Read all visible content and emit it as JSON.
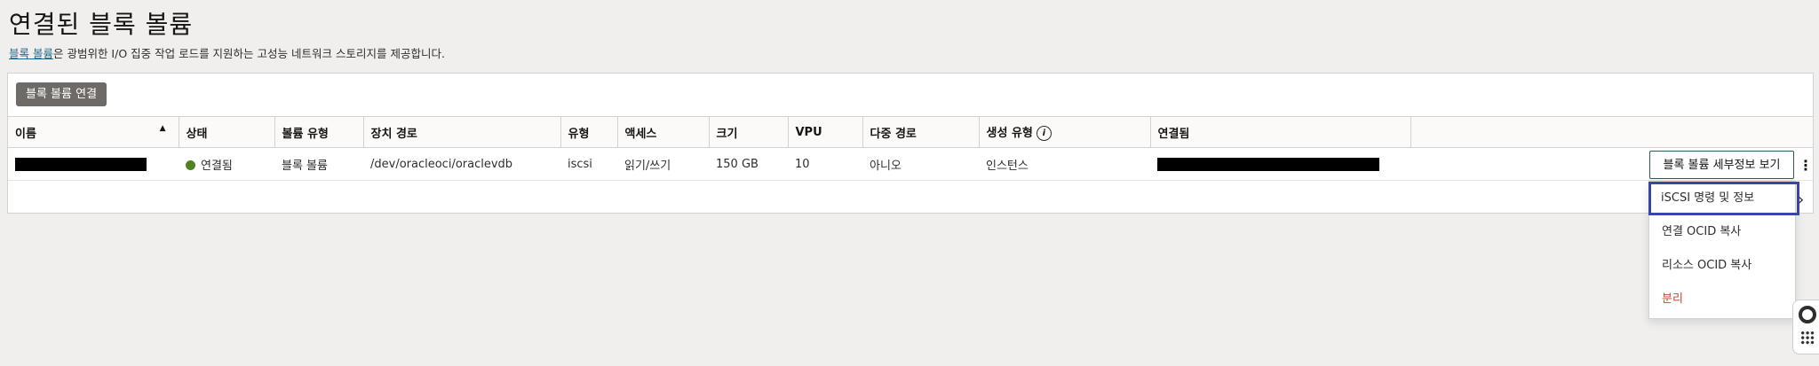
{
  "page": {
    "title": "연결된 블록 볼륨",
    "subtitle_link": "블록 볼륨",
    "subtitle_rest": "은 광범위한 I/O 집중 작업 로드를 지원하는 고성능 네트워크 스토리지를 제공합니다."
  },
  "toolbar": {
    "attach_label": "블록 볼륨 연결"
  },
  "table": {
    "headers": {
      "name": "이름",
      "state": "상태",
      "volume_type": "볼륨 유형",
      "device_path": "장치 경로",
      "type": "유형",
      "access": "액세스",
      "size": "크기",
      "vpu": "VPU",
      "multipath": "다중 경로",
      "created_type": "생성 유형",
      "attached": "연결됨"
    },
    "row": {
      "state": "연결됨",
      "volume_type": "블록 볼륨",
      "device_path": "/dev/oracleoci/oraclevdb",
      "type": "iscsi",
      "access": "읽기/쓰기",
      "size": "150 GB",
      "vpu": "10",
      "multipath": "아니오",
      "created_type": "인스턴스"
    }
  },
  "actions": {
    "view_details": "블록 볼륨 세부정보 보기",
    "menu": [
      "iSCSI 명령 및 정보",
      "연결 OCID 복사",
      "리소스 OCID 복사",
      "분리"
    ]
  },
  "colors": {
    "status_available": "#508223",
    "danger": "#c74634",
    "focus_ring": "#3a45a8"
  }
}
